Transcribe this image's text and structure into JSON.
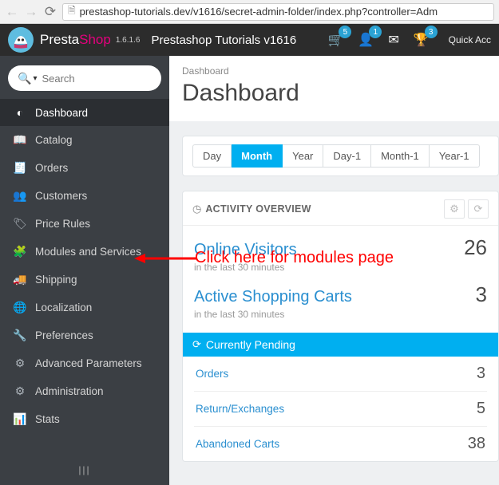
{
  "browser": {
    "url": "prestashop-tutorials.dev/v1616/secret-admin-folder/index.php?controller=Adm"
  },
  "top": {
    "brand_a": "Presta",
    "brand_b": "Shop",
    "version": "1.6.1.6",
    "store": "Prestashop Tutorials v1616",
    "badges": {
      "cart": "5",
      "user": "1",
      "trophy": "3"
    },
    "quick": "Quick Acc"
  },
  "search": {
    "placeholder": "Search"
  },
  "nav": [
    {
      "icon": "◐",
      "label": "Dashboard",
      "active": true
    },
    {
      "icon": "📖",
      "label": "Catalog"
    },
    {
      "icon": "🧾",
      "label": "Orders"
    },
    {
      "icon": "👥",
      "label": "Customers"
    },
    {
      "icon": "🏷",
      "label": "Price Rules"
    },
    {
      "icon": "🧩",
      "label": "Modules and Services"
    },
    {
      "icon": "🚚",
      "label": "Shipping"
    },
    {
      "icon": "🌐",
      "label": "Localization"
    },
    {
      "icon": "🔧",
      "label": "Preferences"
    },
    {
      "icon": "⚙",
      "label": "Advanced Parameters"
    },
    {
      "icon": "⚙",
      "label": "Administration"
    },
    {
      "icon": "📊",
      "label": "Stats"
    }
  ],
  "page": {
    "crumb": "Dashboard",
    "title": "Dashboard"
  },
  "ranges": [
    "Day",
    "Month",
    "Year",
    "Day-1",
    "Month-1",
    "Year-1"
  ],
  "range_active": 1,
  "overview": {
    "title": "ACTIVITY OVERVIEW",
    "metrics": [
      {
        "label": "Online Visitors",
        "sub": "in the last 30 minutes",
        "value": "26"
      },
      {
        "label": "Active Shopping Carts",
        "sub": "in the last 30 minutes",
        "value": "3"
      }
    ],
    "pending": {
      "title": "Currently Pending",
      "items": [
        {
          "label": "Orders",
          "value": "3"
        },
        {
          "label": "Return/Exchanges",
          "value": "5"
        },
        {
          "label": "Abandoned Carts",
          "value": "38"
        }
      ]
    }
  },
  "annotation": "Click here for modules page"
}
